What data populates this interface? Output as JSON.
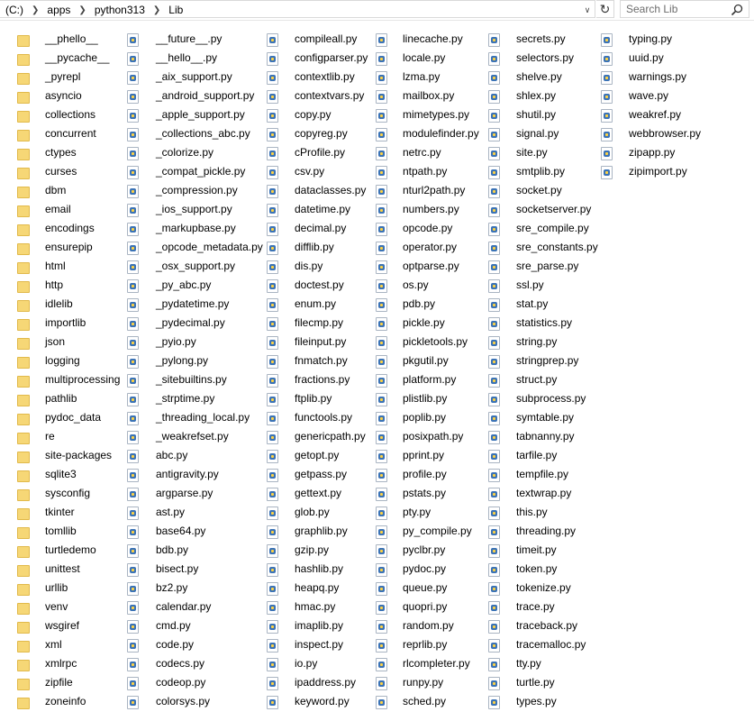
{
  "address_bar": {
    "breadcrumbs": [
      "(C:)",
      "apps",
      "python313",
      "Lib"
    ],
    "search_placeholder": "Search Lib"
  },
  "columns": [
    {
      "type": "folder",
      "items": [
        "__phello__",
        "__pycache__",
        "_pyrepl",
        "asyncio",
        "collections",
        "concurrent",
        "ctypes",
        "curses",
        "dbm",
        "email",
        "encodings",
        "ensurepip",
        "html",
        "http",
        "idlelib",
        "importlib",
        "json",
        "logging",
        "multiprocessing",
        "pathlib",
        "pydoc_data",
        "re",
        "site-packages",
        "sqlite3",
        "sysconfig",
        "tkinter",
        "tomllib",
        "turtledemo",
        "unittest",
        "urllib",
        "venv",
        "wsgiref",
        "xml",
        "xmlrpc",
        "zipfile",
        "zoneinfo"
      ]
    },
    {
      "type": "py",
      "items": [
        "__future__.py",
        "__hello__.py",
        "_aix_support.py",
        "_android_support.py",
        "_apple_support.py",
        "_collections_abc.py",
        "_colorize.py",
        "_compat_pickle.py",
        "_compression.py",
        "_ios_support.py",
        "_markupbase.py",
        "_opcode_metadata.py",
        "_osx_support.py",
        "_py_abc.py",
        "_pydatetime.py",
        "_pydecimal.py",
        "_pyio.py",
        "_pylong.py",
        "_sitebuiltins.py",
        "_strptime.py",
        "_threading_local.py",
        "_weakrefset.py",
        "abc.py",
        "antigravity.py",
        "argparse.py",
        "ast.py",
        "base64.py",
        "bdb.py",
        "bisect.py",
        "bz2.py",
        "calendar.py",
        "cmd.py",
        "code.py",
        "codecs.py",
        "codeop.py",
        "colorsys.py"
      ]
    },
    {
      "type": "py",
      "items": [
        "compileall.py",
        "configparser.py",
        "contextlib.py",
        "contextvars.py",
        "copy.py",
        "copyreg.py",
        "cProfile.py",
        "csv.py",
        "dataclasses.py",
        "datetime.py",
        "decimal.py",
        "difflib.py",
        "dis.py",
        "doctest.py",
        "enum.py",
        "filecmp.py",
        "fileinput.py",
        "fnmatch.py",
        "fractions.py",
        "ftplib.py",
        "functools.py",
        "genericpath.py",
        "getopt.py",
        "getpass.py",
        "gettext.py",
        "glob.py",
        "graphlib.py",
        "gzip.py",
        "hashlib.py",
        "heapq.py",
        "hmac.py",
        "imaplib.py",
        "inspect.py",
        "io.py",
        "ipaddress.py",
        "keyword.py"
      ]
    },
    {
      "type": "py",
      "items": [
        "linecache.py",
        "locale.py",
        "lzma.py",
        "mailbox.py",
        "mimetypes.py",
        "modulefinder.py",
        "netrc.py",
        "ntpath.py",
        "nturl2path.py",
        "numbers.py",
        "opcode.py",
        "operator.py",
        "optparse.py",
        "os.py",
        "pdb.py",
        "pickle.py",
        "pickletools.py",
        "pkgutil.py",
        "platform.py",
        "plistlib.py",
        "poplib.py",
        "posixpath.py",
        "pprint.py",
        "profile.py",
        "pstats.py",
        "pty.py",
        "py_compile.py",
        "pyclbr.py",
        "pydoc.py",
        "queue.py",
        "quopri.py",
        "random.py",
        "reprlib.py",
        "rlcompleter.py",
        "runpy.py",
        "sched.py"
      ]
    },
    {
      "type": "py",
      "items": [
        "secrets.py",
        "selectors.py",
        "shelve.py",
        "shlex.py",
        "shutil.py",
        "signal.py",
        "site.py",
        "smtplib.py",
        "socket.py",
        "socketserver.py",
        "sre_compile.py",
        "sre_constants.py",
        "sre_parse.py",
        "ssl.py",
        "stat.py",
        "statistics.py",
        "string.py",
        "stringprep.py",
        "struct.py",
        "subprocess.py",
        "symtable.py",
        "tabnanny.py",
        "tarfile.py",
        "tempfile.py",
        "textwrap.py",
        "this.py",
        "threading.py",
        "timeit.py",
        "token.py",
        "tokenize.py",
        "trace.py",
        "traceback.py",
        "tracemalloc.py",
        "tty.py",
        "turtle.py",
        "types.py"
      ]
    },
    {
      "type": "py",
      "items": [
        "typing.py",
        "uuid.py",
        "warnings.py",
        "wave.py",
        "weakref.py",
        "webbrowser.py",
        "zipapp.py",
        "zipimport.py"
      ]
    }
  ]
}
